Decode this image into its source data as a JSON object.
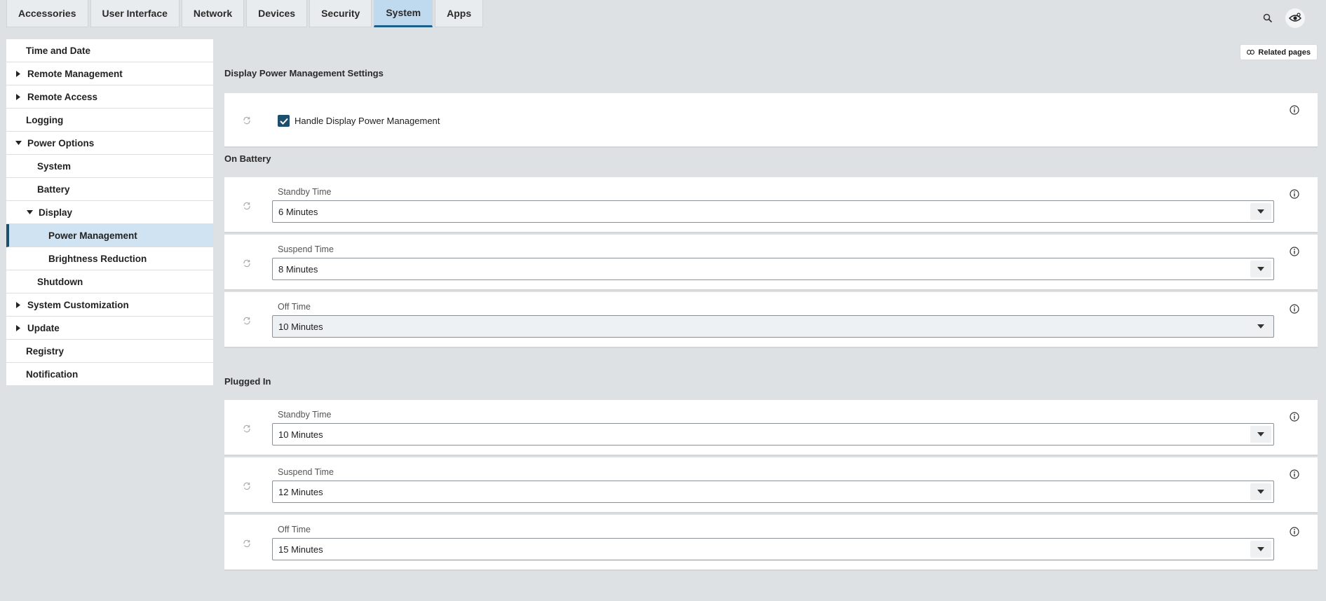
{
  "tabs": [
    "Accessories",
    "User Interface",
    "Network",
    "Devices",
    "Security",
    "System",
    "Apps"
  ],
  "active_tab": "System",
  "top_icons": [
    "search-icon",
    "eye-settings-icon"
  ],
  "sidebar": {
    "items": [
      {
        "label": "Time and Date"
      },
      {
        "label": "Remote Management",
        "caret": "right"
      },
      {
        "label": "Remote Access",
        "caret": "right"
      },
      {
        "label": "Logging"
      },
      {
        "label": "Power Options",
        "caret": "down"
      },
      {
        "label": "System"
      },
      {
        "label": "Battery"
      },
      {
        "label": "Display",
        "caret": "down"
      },
      {
        "label": "Power Management",
        "selected": true
      },
      {
        "label": "Brightness Reduction"
      },
      {
        "label": "Shutdown"
      },
      {
        "label": "System Customization",
        "caret": "right"
      },
      {
        "label": "Update",
        "caret": "right"
      },
      {
        "label": "Registry"
      },
      {
        "label": "Notification"
      }
    ]
  },
  "related_pages": "Related pages",
  "main": {
    "title": "Display Power Management Settings",
    "handle_checkbox": {
      "label": "Handle Display Power Management",
      "checked": true
    },
    "on_battery": {
      "title": "On Battery",
      "fields": [
        {
          "label": "Standby Time",
          "value": "6 Minutes"
        },
        {
          "label": "Suspend Time",
          "value": "8 Minutes"
        },
        {
          "label": "Off Time",
          "value": "10 Minutes"
        }
      ]
    },
    "plugged_in": {
      "title": "Plugged In",
      "fields": [
        {
          "label": "Standby Time",
          "value": "10 Minutes"
        },
        {
          "label": "Suspend Time",
          "value": "12 Minutes"
        },
        {
          "label": "Off Time",
          "value": "15 Minutes"
        }
      ]
    }
  },
  "colors": {
    "accent": "#1c4f6d",
    "active_tab_bg": "#bfd9ee",
    "selected_item_bg": "#cfe3f3",
    "page_bg": "#dde1e4"
  }
}
